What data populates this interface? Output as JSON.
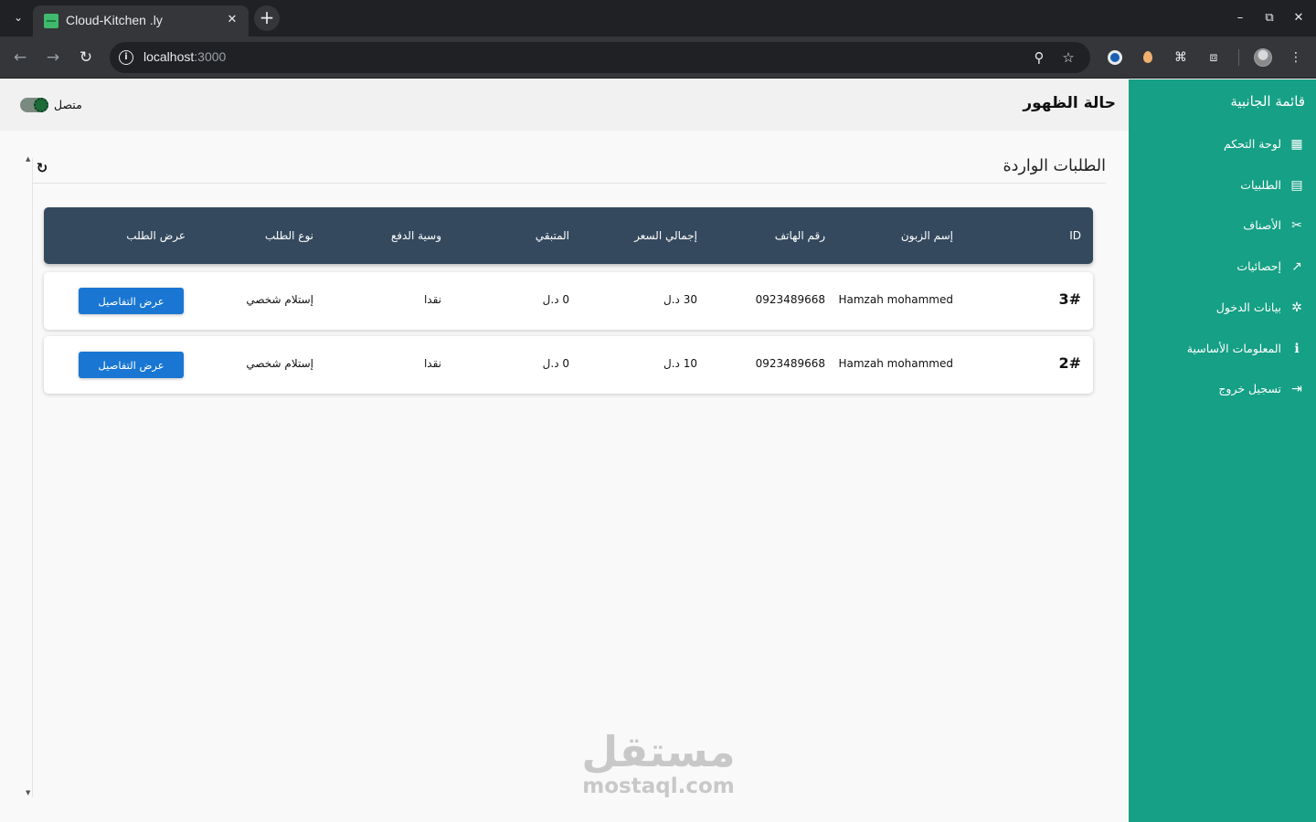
{
  "browser": {
    "tab_title": "Cloud-Kitchen .ly",
    "url_host": "localhost",
    "url_port": ":3000"
  },
  "sidebar": {
    "title": "قائمة الجانبية",
    "items": [
      {
        "label": "لوحة التحكم",
        "icon": "dashboard-icon",
        "glyph": "▦"
      },
      {
        "label": "الطلبيات",
        "icon": "archive-icon",
        "glyph": "▤"
      },
      {
        "label": "الأصناف",
        "icon": "utensils-icon",
        "glyph": "✂"
      },
      {
        "label": "إحصائيات",
        "icon": "chart-trend-icon",
        "glyph": "↗"
      },
      {
        "label": "بيانات الدخول",
        "icon": "login-data-icon",
        "glyph": "✲"
      },
      {
        "label": "المعلومات الأساسية",
        "icon": "info-icon",
        "glyph": "ℹ"
      },
      {
        "label": "تسجيل خروج",
        "icon": "logout-icon",
        "glyph": "⇥"
      }
    ]
  },
  "header": {
    "title": "حالة الظهور",
    "status_label": "متصل"
  },
  "orders": {
    "title": "الطلبات الواردة",
    "columns": {
      "id": "ID",
      "customer": "إسم الزبون",
      "phone": "رقم الهاتف",
      "total": "إجمالي السعر",
      "remaining": "المتبقي",
      "payment": "وسية الدفع",
      "type": "نوع الطلب",
      "view": "عرض الطلب"
    },
    "rows": [
      {
        "id": "3#",
        "customer": "Hamzah mohammed",
        "phone": "0923489668",
        "total": "30 د.ل",
        "remaining": "0 د.ل",
        "payment": "نقدا",
        "type": "إستلام شخصي",
        "button": "عرض التفاصيل"
      },
      {
        "id": "2#",
        "customer": "Hamzah mohammed",
        "phone": "0923489668",
        "total": "10 د.ل",
        "remaining": "0 د.ل",
        "payment": "نقدا",
        "type": "إستلام شخصي",
        "button": "عرض التفاصيل"
      }
    ]
  },
  "watermark": {
    "arabic": "مستقل",
    "latin": "mostaql.com"
  },
  "colors": {
    "sidebar": "#16a085",
    "table_header": "#34495e",
    "button": "#1976d2"
  }
}
